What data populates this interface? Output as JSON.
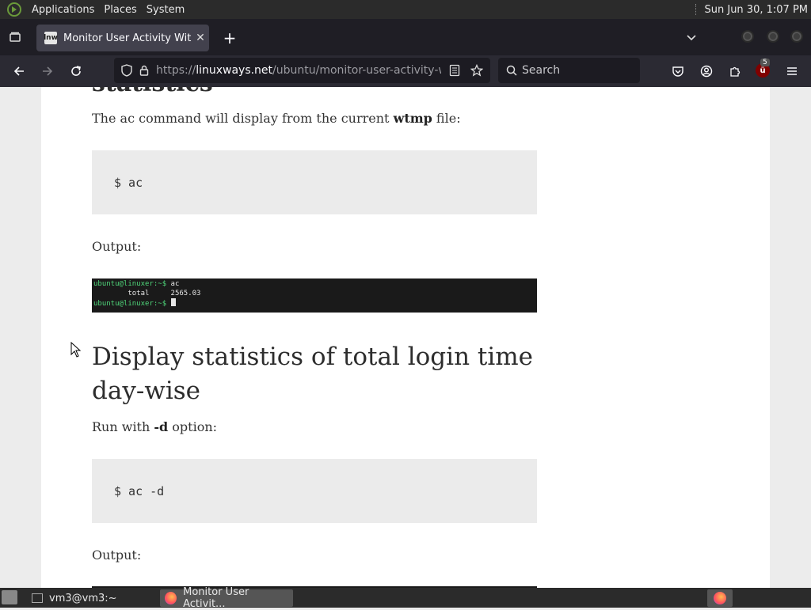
{
  "system_bar": {
    "menus": [
      "Applications",
      "Places",
      "System"
    ],
    "clock": "Sun Jun 30,  1:07 PM"
  },
  "browser": {
    "tab": {
      "title": "Monitor User Activity With a",
      "favicon_text": "lnw"
    },
    "url": {
      "scheme": "https://",
      "host": "linuxways.net",
      "path": "/ubuntu/monitor-user-activity-with"
    },
    "search_placeholder": "Search",
    "extension_badge": "5"
  },
  "article": {
    "heading_partial": "statistics",
    "intro_pre": "The ac command will display from the current ",
    "intro_bold": "wtmp",
    "intro_post": " file:",
    "code1": "$ ac",
    "output1_label": "Output:",
    "terminal": {
      "line1_prompt": "ubuntu@linuxer:~$",
      "line1_cmd": " ac",
      "line2": "        total     2565.03",
      "line3_prompt": "ubuntu@linuxer:~$"
    },
    "h2": "Display statistics of total login time day-wise",
    "run_pre": "Run with ",
    "run_bold": "-d",
    "run_post": " option:",
    "code2": "$ ac -d",
    "output2_label": "Output:"
  },
  "taskbar": {
    "items": [
      "vm3@vm3:~",
      "Monitor User Activit..."
    ]
  },
  "colors": {
    "chrome_dark": "#2b2a33",
    "tab_active": "#42414d",
    "terminal_prompt": "#4fd67a"
  }
}
